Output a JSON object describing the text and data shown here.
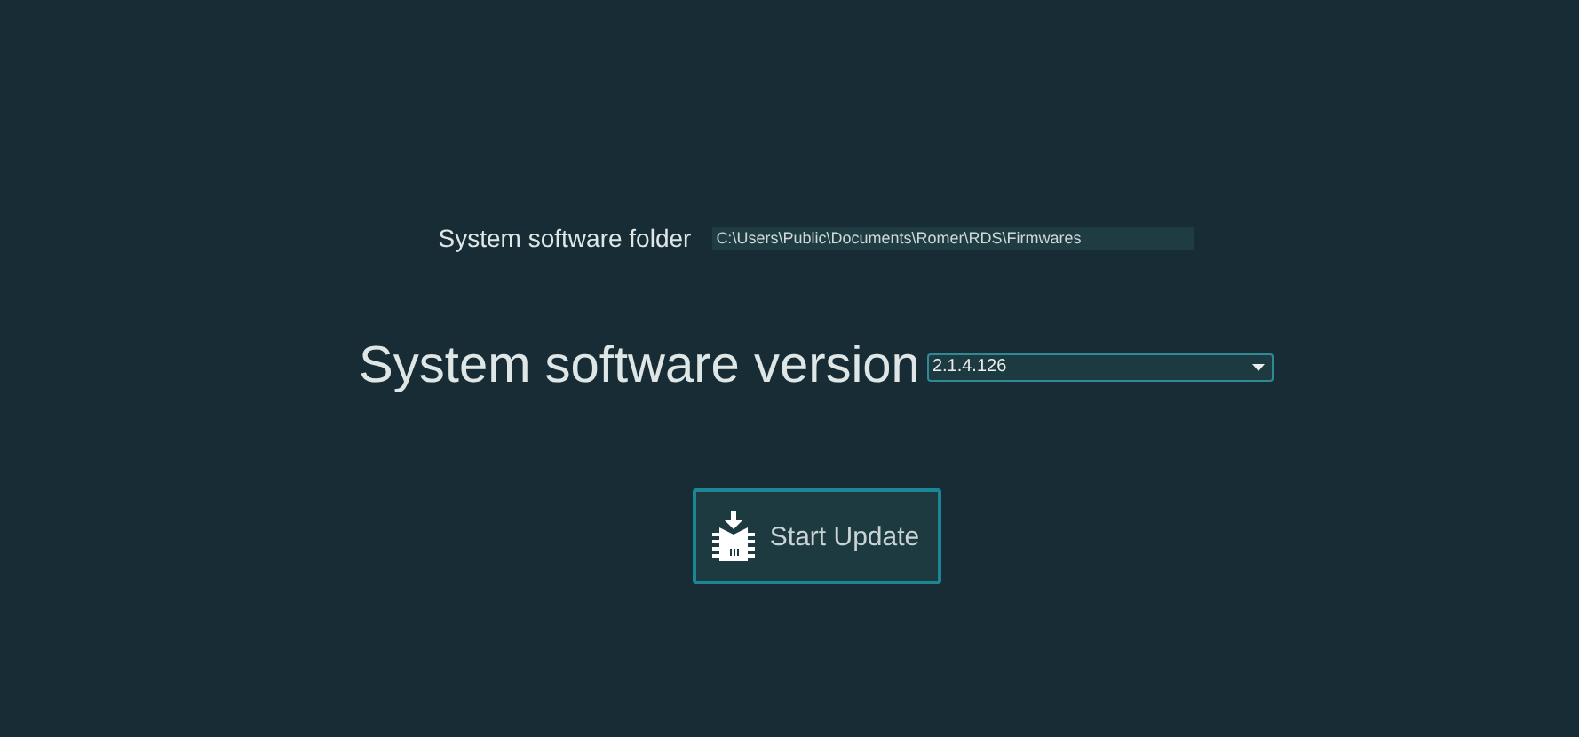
{
  "folder": {
    "label": "System software folder",
    "value": "C:\\Users\\Public\\Documents\\Romer\\RDS\\Firmwares"
  },
  "version": {
    "label": "System software version",
    "value": "2.1.4.126"
  },
  "button": {
    "label": "Start Update"
  }
}
